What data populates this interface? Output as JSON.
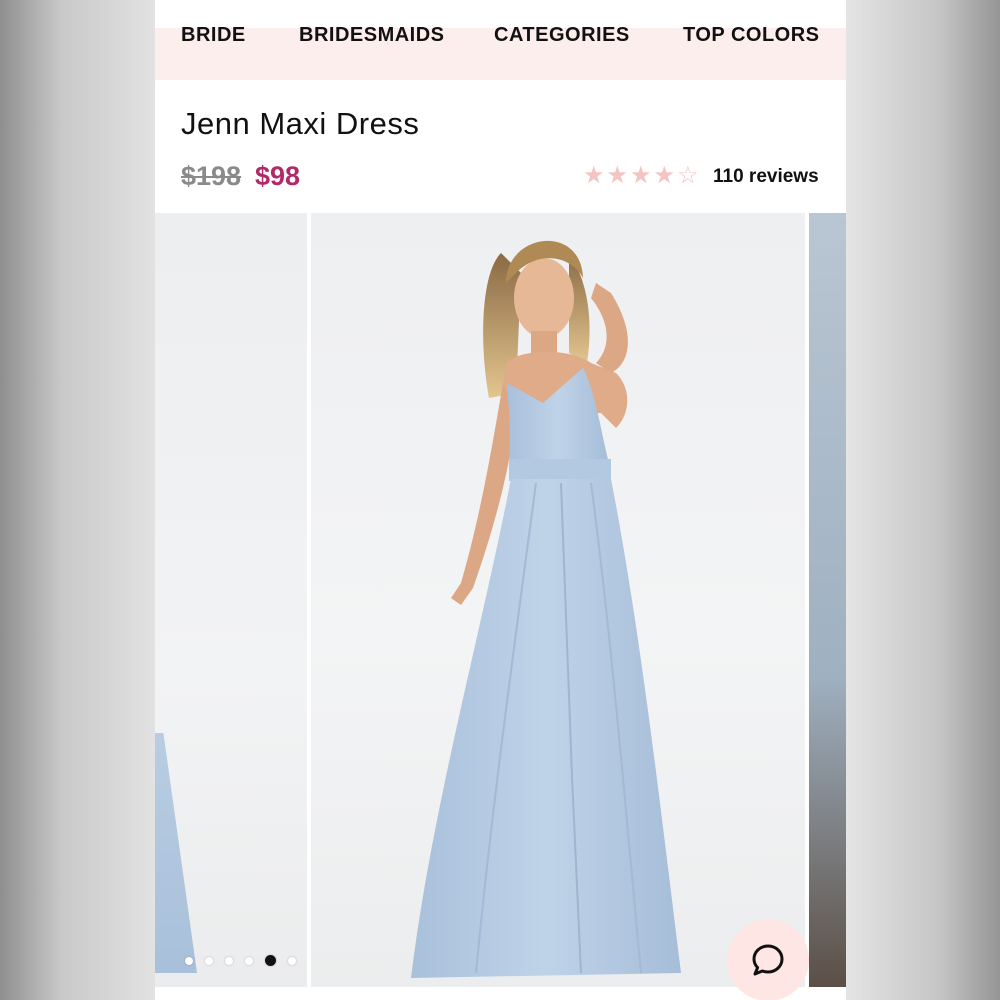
{
  "nav": {
    "items": [
      {
        "label": "BRIDE"
      },
      {
        "label": "BRIDESMAIDS"
      },
      {
        "label": "CATEGORIES"
      },
      {
        "label": "TOP COLORS"
      }
    ]
  },
  "product": {
    "title": "Jenn Maxi Dress",
    "price_original": "$198",
    "price_sale": "$98",
    "rating": 4,
    "rating_max": 5,
    "reviews_label": "110 reviews"
  },
  "gallery": {
    "slide_count": 6,
    "active_slide": 4
  },
  "colors": {
    "nav_bg": "#fdeeee",
    "sale_price": "#b2296b",
    "star": "#f3c4c2",
    "dress": "#b7cce3",
    "chat_bg": "#fde6e4"
  },
  "icons": {
    "star": "star-icon",
    "chat": "chat-bubble-icon"
  }
}
